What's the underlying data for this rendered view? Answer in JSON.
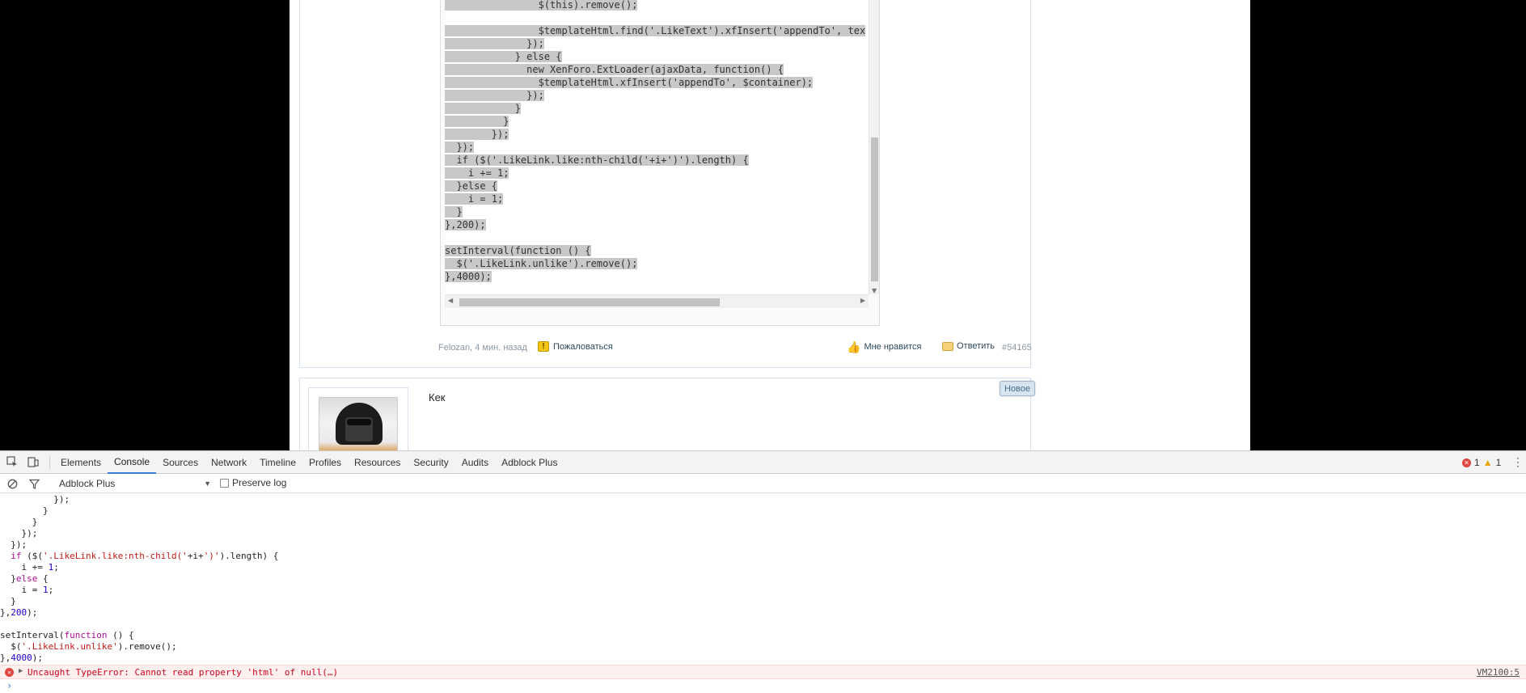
{
  "page": {
    "code_lines": [
      "                $(this).remove();",
      "",
      "                $templateHtml.find('.LikeText').xfInsert('appendTo', tex",
      "              });",
      "            } else {",
      "              new XenForo.ExtLoader(ajaxData, function() {",
      "                $templateHtml.xfInsert('appendTo', $container);",
      "              });",
      "            }",
      "          }",
      "        });",
      "  });",
      "  if ($('.LikeLink.like:nth-child('+i+')').length) {",
      "    i += 1;",
      "  }else {",
      "    i = 1;",
      "  }",
      "},200);",
      "",
      "setInterval(function () {",
      "  $('.LikeLink.unlike').remove();",
      "},4000);"
    ],
    "post_meta": {
      "author_date": "Felozan, 4 мин. назад",
      "report_label": "Пожаловаться",
      "like_label": "Мне нравится",
      "reply_label": "Ответить",
      "post_number": "#54165"
    },
    "next_post": {
      "text": "Кек",
      "badge": "Новое"
    }
  },
  "devtools": {
    "tabs": [
      "Elements",
      "Console",
      "Sources",
      "Network",
      "Timeline",
      "Profiles",
      "Resources",
      "Security",
      "Audits",
      "Adblock Plus"
    ],
    "active_tab": "Console",
    "error_count": "1",
    "warning_count": "1",
    "context": "Adblock Plus",
    "preserve_log_label": "Preserve log",
    "error": {
      "message": "Uncaught TypeError: Cannot read property 'html' of null(…)",
      "source": "VM2100:5"
    },
    "prompt_symbol": "›"
  },
  "colors": {
    "accent_blue": "#3879d9",
    "error_red": "#e0443e",
    "warning_orange": "#e8a600",
    "code_selection": "#c8c8c8"
  }
}
